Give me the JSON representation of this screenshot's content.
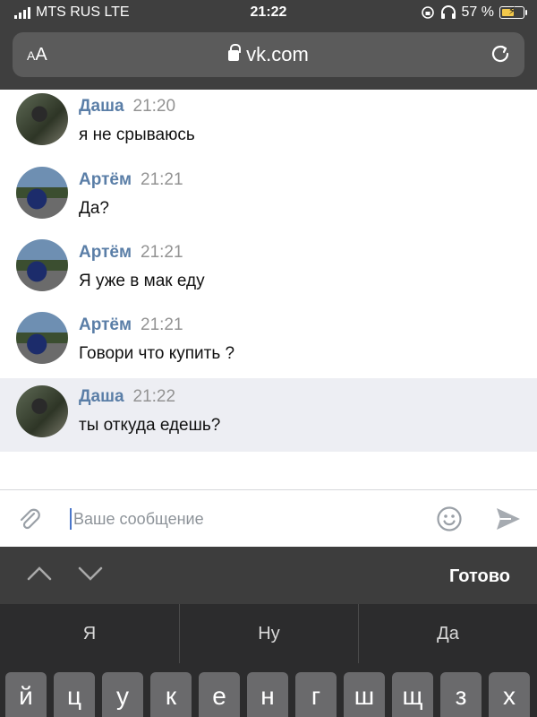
{
  "status_bar": {
    "carrier": "MTS RUS LTE",
    "time": "21:22",
    "battery": "57 %",
    "battery_level": 0.57
  },
  "browser": {
    "text_size_label_small": "A",
    "text_size_label_large": "A",
    "url": "vk.com"
  },
  "messages": [
    {
      "author": "Даша",
      "time": "21:20",
      "text": "я не срываюсь",
      "avatar": "dasha"
    },
    {
      "author": "Артём",
      "time": "21:21",
      "text": "Да?",
      "avatar": "artem"
    },
    {
      "author": "Артём",
      "time": "21:21",
      "text": "Я уже в мак еду",
      "avatar": "artem"
    },
    {
      "author": "Артём",
      "time": "21:21",
      "text": "Говори что купить ?",
      "avatar": "artem"
    },
    {
      "author": "Даша",
      "time": "21:22",
      "text": "ты откуда едешь?",
      "avatar": "dasha"
    }
  ],
  "composer": {
    "placeholder": "Ваше сообщение"
  },
  "keyboard": {
    "done_label": "Готово",
    "suggestions": [
      "Я",
      "Ну",
      "Да"
    ],
    "keys": [
      "й",
      "ц",
      "у",
      "к",
      "е",
      "н",
      "г",
      "ш",
      "щ",
      "з",
      "х"
    ]
  },
  "colors": {
    "author": "#5a7ea7",
    "highlight": "#edeef3",
    "accent": "#4a76c9"
  },
  "icons": [
    "signal-icon",
    "lock-icon",
    "reload-icon",
    "headphones-icon",
    "rotation-lock-icon",
    "battery-icon",
    "attach-icon",
    "emoji-icon",
    "send-icon",
    "chevron-up-icon",
    "chevron-down-icon"
  ]
}
